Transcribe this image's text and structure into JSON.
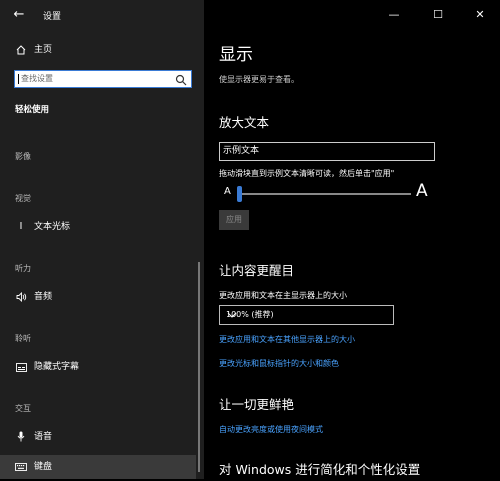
{
  "window": {
    "title": "设置",
    "back_glyph": "←",
    "minimize_glyph": "—",
    "maximize_glyph": "☐",
    "close_glyph": "✕"
  },
  "sidebar": {
    "home_label": "主页",
    "search_placeholder": "查找设置",
    "section_title": "轻松使用",
    "categories": {
      "vision": "影像",
      "vision2": "视觉",
      "hearing": "听力",
      "interaction_audio": "聆听",
      "interaction": "交互"
    },
    "items": {
      "text_cursor": "文本光标",
      "audio": "音频",
      "closed_captions": "隐藏式字幕",
      "speech": "语音",
      "keyboard": "键盘"
    }
  },
  "main": {
    "title": "显示",
    "subtitle": "使显示器更易于查看。",
    "make_text_bigger": {
      "heading": "放大文本",
      "sample_text": "示例文本",
      "slider_desc": "拖动滑块直到示例文本清晰可读，然后单击\"应用\"",
      "small_a": "A",
      "big_a": "A",
      "slider_value_fraction": 0.0,
      "apply_label": "应用"
    },
    "make_everything_bigger": {
      "heading": "让内容更醒目",
      "label": "更改应用和文本在主显示器上的大小",
      "selected": "100% (推荐)",
      "link1": "更改应用和文本在其他显示器上的大小",
      "link2": "更改光标和鼠标指针的大小和颜色"
    },
    "make_everything_brighter": {
      "heading": "让一切更鲜艳",
      "link": "自动更改亮度或使用夜间模式"
    },
    "simplify_heading": "对 Windows 进行简化和个性化设置"
  },
  "colors": {
    "sidebar_bg": "#1f1f1f",
    "main_bg": "#000000",
    "accent": "#3a7bd5",
    "link": "#4aa3ff"
  }
}
